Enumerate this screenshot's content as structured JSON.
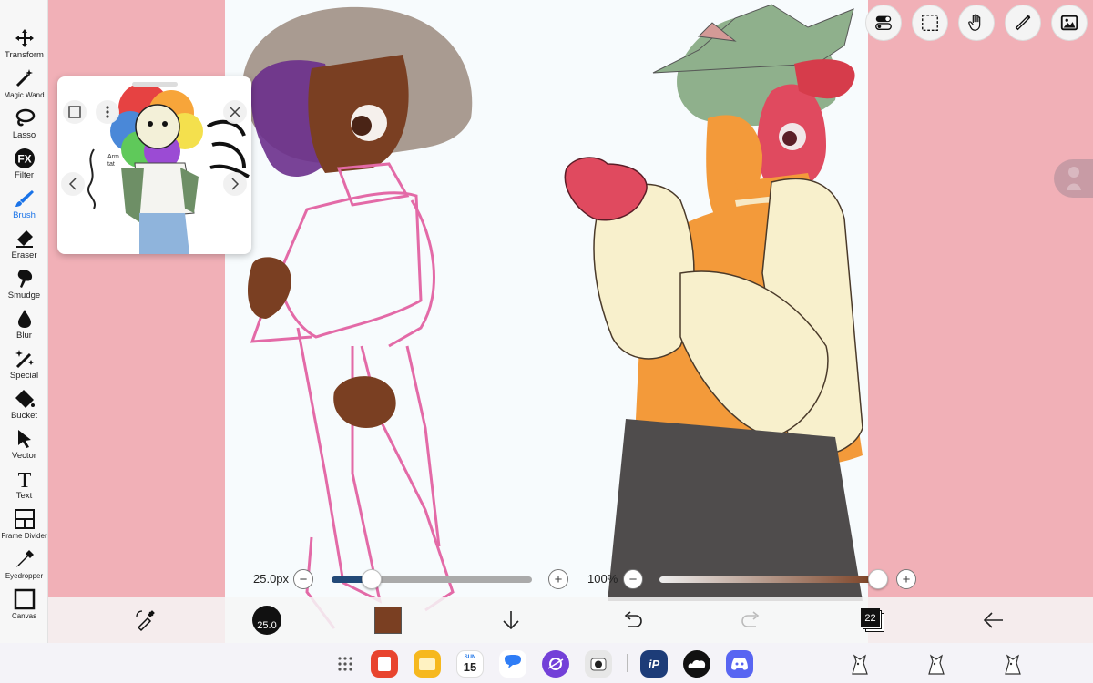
{
  "tools": [
    {
      "label": "Transform",
      "icon": "transform-icon"
    },
    {
      "label": "Magic Wand",
      "icon": "magic-wand-icon"
    },
    {
      "label": "Lasso",
      "icon": "lasso-icon"
    },
    {
      "label": "Filter",
      "icon": "filter-icon",
      "badge": "FX"
    },
    {
      "label": "Brush",
      "icon": "brush-icon",
      "active": true
    },
    {
      "label": "Eraser",
      "icon": "eraser-icon"
    },
    {
      "label": "Smudge",
      "icon": "smudge-icon"
    },
    {
      "label": "Blur",
      "icon": "blur-icon"
    },
    {
      "label": "Special",
      "icon": "special-icon"
    },
    {
      "label": "Bucket",
      "icon": "bucket-icon"
    },
    {
      "label": "Vector",
      "icon": "vector-icon"
    },
    {
      "label": "Text",
      "icon": "text-icon",
      "glyph": "T"
    },
    {
      "label": "Frame Divider",
      "icon": "frame-divider-icon"
    },
    {
      "label": "Eyedropper",
      "icon": "eyedropper-icon"
    },
    {
      "label": "Canvas",
      "icon": "canvas-icon"
    }
  ],
  "brush": {
    "size_label": "25.0px",
    "size_value": 25.0,
    "size_fraction": 0.2,
    "minus": "−",
    "plus": "+"
  },
  "opacity": {
    "label": "100%",
    "fraction": 1.0,
    "minus": "−",
    "plus": "+"
  },
  "bottom": {
    "brush_size_badge": "25.0",
    "current_color": "#7a3f22",
    "layers_count": "22"
  },
  "reference": {
    "note_text": "Arm\ntat"
  },
  "taskbar": {
    "calendar_day": "SUN",
    "calendar_date": "15"
  },
  "colors": {
    "background": "#f1b0b7",
    "canvas": "#f7fbfd",
    "accent": "#1a73e8"
  }
}
